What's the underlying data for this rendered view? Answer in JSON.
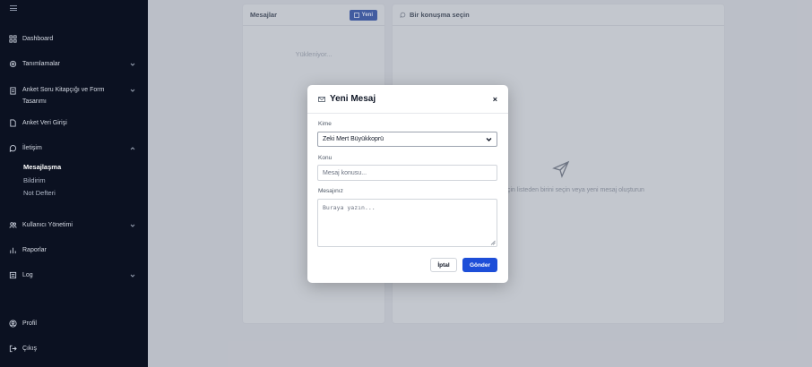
{
  "sidebar": {
    "items": [
      {
        "label": "Dashboard"
      },
      {
        "label": "Tanımlamalar"
      },
      {
        "label_line1": "Anket Soru Kitapçığı ve Form",
        "label_line2": "Tasarımı"
      },
      {
        "label": "Anket Veri Girişi"
      },
      {
        "label": "İletişim"
      },
      {
        "label": "Kullanıcı Yönetimi"
      },
      {
        "label": "Raporlar"
      },
      {
        "label": "Log"
      },
      {
        "label": "Profil"
      },
      {
        "label": "Çıkış"
      }
    ],
    "subitems": [
      "Mesajlaşma",
      "Bildirim",
      "Not Defteri"
    ]
  },
  "messages_panel": {
    "title": "Mesajlar",
    "new_button": "Yeni",
    "loading_text": "Yükleniyor..."
  },
  "conversation_panel": {
    "title": "Bir konuşma seçin",
    "empty_text": "ek için listeden birini seçin veya yeni mesaj oluşturun"
  },
  "modal": {
    "title": "Yeni Mesaj",
    "close": "×",
    "to_label": "Kime",
    "to_value": "Zeki Mert Büyükkoprü",
    "subject_label": "Konu",
    "subject_placeholder": "Mesaj konusu...",
    "message_label": "Mesajınız",
    "message_placeholder": "Buraya yazın...",
    "cancel_button": "İptal",
    "send_button": "Gönder"
  },
  "colors": {
    "sidebar_bg": "#0b1121",
    "primary": "#1d4ed8"
  }
}
